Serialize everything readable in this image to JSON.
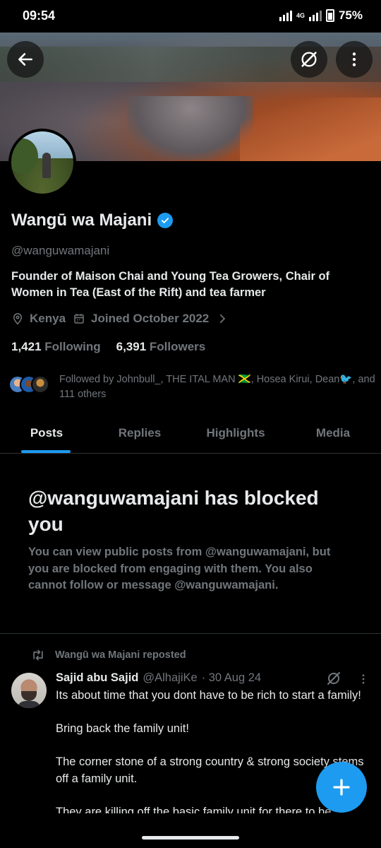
{
  "status_bar": {
    "time": "09:54",
    "network": "4G",
    "battery": "75%"
  },
  "profile": {
    "name": "Wangū wa Majani",
    "handle": "@wanguwamajani",
    "bio": "Founder of Maison Chai and Young Tea Growers, Chair of Women in Tea (East of the Rift) and tea farmer",
    "location": "Kenya",
    "joined": "Joined October 2022",
    "following_count": "1,421",
    "following_label": "Following",
    "followers_count": "6,391",
    "followers_label": "Followers",
    "followed_by": "Followed by Johnbull_, THE ITAL MAN 🇯🇲, Hosea Kirui, Dean🐦, and 111 others"
  },
  "tabs": [
    {
      "label": "Posts",
      "active": true
    },
    {
      "label": "Replies",
      "active": false
    },
    {
      "label": "Highlights",
      "active": false
    },
    {
      "label": "Media",
      "active": false
    }
  ],
  "blocked": {
    "title": "@wanguwamajani has blocked you",
    "body": "You can view public posts from @wanguwamajani, but you are blocked from engaging with them. You also cannot follow or message @wanguwamajani."
  },
  "post": {
    "repost_label": "Wangū wa Majani reposted",
    "author_name": "Sajid abu Sajid",
    "author_handle": "@AlhajiKe",
    "date": "· 30 Aug 24",
    "paragraphs": [
      "Its about time that you dont have to be rich to start a family!",
      "Bring back the family unit!",
      "The corner stone of a strong country & strong society stems off a family unit.",
      "They are killing off the basic family unit for there to be"
    ]
  },
  "colors": {
    "accent": "#1d9bf0",
    "background": "#000000",
    "text_primary": "#e7e9ea",
    "text_secondary": "#71767b",
    "border": "#2f3336"
  },
  "icons": {
    "back": "arrow-left-icon",
    "grok": "grok-icon",
    "more": "more-vertical-icon",
    "verified": "verified-badge-icon",
    "location": "location-pin-icon",
    "calendar": "calendar-icon",
    "chevron": "chevron-right-icon",
    "repost": "repost-icon",
    "compose": "plus-icon"
  }
}
